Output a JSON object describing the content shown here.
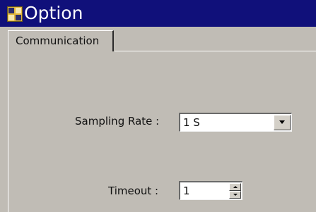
{
  "window": {
    "title": "Option",
    "icon": "app-logo-icon",
    "titlebar_color": "#10107a"
  },
  "tabs": [
    {
      "label": "Communication",
      "selected": true
    }
  ],
  "fields": {
    "sampling_rate": {
      "label": "Sampling Rate :",
      "value": "1 S",
      "control": "dropdown",
      "icon": "chevron-down-icon"
    },
    "timeout": {
      "label": "Timeout :",
      "value": "1",
      "control": "spinner",
      "icons": [
        "spin-up-icon",
        "spin-down-icon"
      ]
    }
  }
}
